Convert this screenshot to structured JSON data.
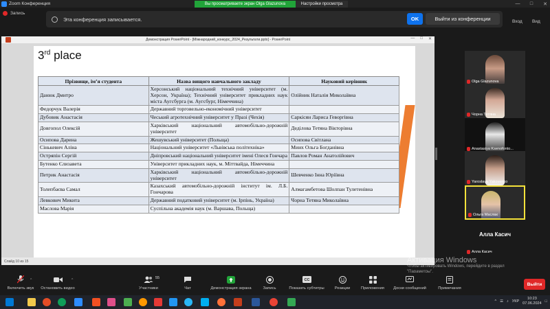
{
  "window": {
    "title": "Zoom Конференция"
  },
  "titlebar": {
    "share_banner": "Вы просматриваете экран Olga Glazunova",
    "view_settings": "Настройки просмотра"
  },
  "recording": {
    "status": "Запись",
    "notice": "Эта конференция записывается.",
    "ok_label": "OK",
    "leave_conf_label": "Выйти из конференции",
    "enter_label": "Вход",
    "view_label": "Вид"
  },
  "ppt": {
    "window_title": "Демонстрация PowerPoint - [Міжнародний_конкурс_2024_Результати.pptx] - PowerPoint",
    "status": "Слайд 10 из 15"
  },
  "slide": {
    "title_num": "3",
    "title_sup": "rd",
    "title_rest": " place",
    "table": {
      "headers": [
        "Прізвище, ім’я студента",
        "Назва вищого навчального закладу",
        "Науковий керівник"
      ],
      "rows": [
        [
          "Данюк Дмитро",
          "Херсонський національний технічний університет (м. Херсон, Україна); Технічний університет прикладних наук міста Аугсбурга (м. Аугсбург, Німеччина)",
          "Олійник Наталія Миколаївна"
        ],
        [
          "Федорчук Валерія",
          "Державний торговельно-економічний університет",
          ""
        ],
        [
          "Дубовик Анастасія",
          "Чеський агротехнічний університет у Празі (Чехія)",
          "Саркісян Лариса Геворгівна"
        ],
        [
          "Довгопол Олексій",
          "Харківський національний автомобільно-дорожній університет",
          "Дедiлова Тетяна Вікторівна"
        ],
        [
          "Осипова Дарина",
          "Жешувський університет (Польща)",
          "Осипова Світлана"
        ],
        [
          "Сінькевич Аліна",
          "Національний університет «Львівська політехніка»",
          "Миих Ольга Богданівна"
        ],
        [
          "Остряпін Сергій",
          "Дніпровський національний університет імені Олеся Гончара",
          "Павлов Роман Анатолійович"
        ],
        [
          "Бутенко Єлизавета",
          "Університет прикладних наук, м. Міттвайда, Німеччина",
          ""
        ],
        [
          "Петрик Анастасія",
          "Харківський національний автомобільно-дорожній університет",
          "Шевченко Інна Юріївна"
        ],
        [
          "Толепбаєва Самал",
          "Казахський автомобільно-дорожній інститут ім. Л.Б. Гончарова",
          "Алмагамбетова Шолпан Тулетенівна"
        ],
        [
          "Левкович Микита",
          "Державний податковий університет (м. Ірпінь, Україна)",
          "Чорна Тетяна Миколаївна"
        ],
        [
          "Маслова Марія",
          "Суспільна академія наук (м. Варшава, Польща)",
          ""
        ]
      ]
    }
  },
  "gallery": {
    "participants": [
      {
        "name": "Olga Glazunova",
        "mic": "on"
      },
      {
        "name": "Чорна Тетяна",
        "mic": "muted"
      },
      {
        "name": "Anastasiya Ksenofonto...",
        "mic": "muted"
      },
      {
        "name": "Yaroslava Yakovenko",
        "mic": "muted"
      },
      {
        "name": "Ольга Маслак",
        "mic": "muted"
      },
      {
        "name": "Алла Касич",
        "display": "Алла Касич",
        "mic": "muted"
      }
    ]
  },
  "watermark": {
    "line1": "Активация Windows",
    "line2": "Чтобы активировать Windows, перейдите в раздел",
    "line3": "\"Параметры\"."
  },
  "toolbar": {
    "mic": "Включить звук",
    "video": "Остановить видео",
    "participants": "Участники",
    "participants_count": "55",
    "chat": "Чат",
    "share": "Демонстрация экрана",
    "record": "Запись",
    "captions": "Показать субтитры",
    "reactions": "Реакции",
    "apps": "Приложения",
    "whiteboards": "Доски сообщений",
    "notes": "Примечания",
    "leave": "Выйти"
  },
  "taskbar": {
    "lang": "УКР",
    "time": "10:23",
    "date": "07.06.2024"
  },
  "colors": {
    "share_green": "#21a439",
    "zoom_blue": "#0e72ed",
    "leave_red": "#e02828",
    "active_speaker": "#f6e23a",
    "slide_orange": "#ed7d31"
  }
}
